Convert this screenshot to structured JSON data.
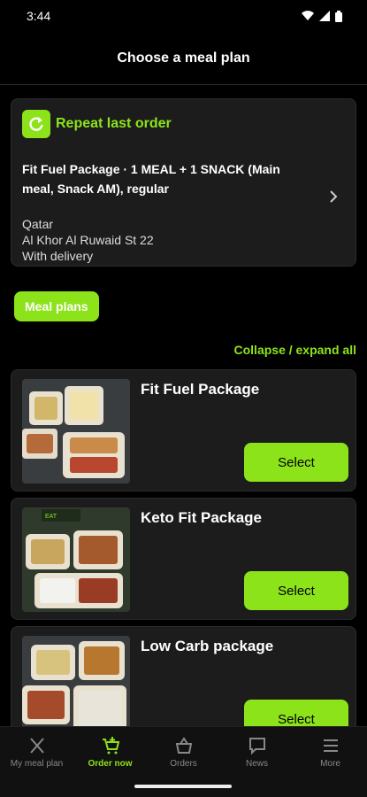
{
  "status": {
    "time": "3:44"
  },
  "header": {
    "title": "Choose a meal plan"
  },
  "repeat": {
    "label": "Repeat last order",
    "description": "Fit Fuel Package · 1 MEAL + 1 SNACK (Main meal, Snack AM), regular",
    "country": "Qatar",
    "address": "Al Khor Al Ruwaid St 22",
    "delivery": "With delivery"
  },
  "meal_plans_label": "Meal plans",
  "collapse_label": "Collapse / expand all",
  "packages": [
    {
      "name": "Fit Fuel Package",
      "select": "Select"
    },
    {
      "name": "Keto Fit Package",
      "select": "Select"
    },
    {
      "name": "Low Carb package",
      "select": "Select"
    }
  ],
  "nav": [
    {
      "label": "My meal plan",
      "icon": "fork-knife-icon"
    },
    {
      "label": "Order now",
      "icon": "cart-icon",
      "active": true
    },
    {
      "label": "Orders",
      "icon": "basket-icon"
    },
    {
      "label": "News",
      "icon": "message-icon"
    },
    {
      "label": "More",
      "icon": "menu-icon"
    }
  ],
  "colors": {
    "accent": "#8de31a",
    "card": "#1c1c1c",
    "background": "#000000"
  }
}
